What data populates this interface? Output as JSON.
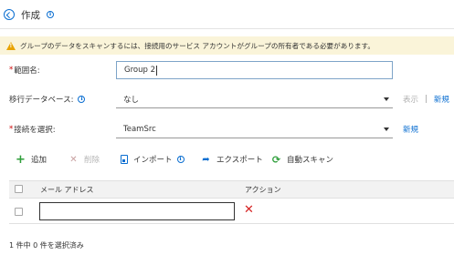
{
  "header": {
    "title": "作成"
  },
  "warning": {
    "text": "グループのデータをスキャンするには、接続用のサービス アカウントがグループの所有者である必要があります。"
  },
  "form": {
    "scope_name": {
      "required_mark": "*",
      "label": "範囲名:",
      "value": "Group 2"
    },
    "migration_db": {
      "label": "移行データベース:",
      "value": "なし",
      "view_link": "表示",
      "separator": "|",
      "new_link": "新規"
    },
    "connection": {
      "required_mark": "*",
      "label": "接続を選択:",
      "value": "TeamSrc",
      "new_link": "新規"
    }
  },
  "toolbar": {
    "add": "追加",
    "delete": "削除",
    "import": "インポート",
    "export": "エクスポート",
    "autoscan": "自動スキャン"
  },
  "table": {
    "columns": [
      "メール アドレス",
      "アクション"
    ],
    "rows": [
      {
        "email": ""
      }
    ]
  },
  "footer": {
    "selection_status": "1 件中 0 件を選択済み"
  },
  "colors": {
    "accent": "#0a6ed1",
    "warning_bg": "#faf4d9",
    "add_green": "#2e9e3a",
    "delete_red": "#d62323"
  }
}
